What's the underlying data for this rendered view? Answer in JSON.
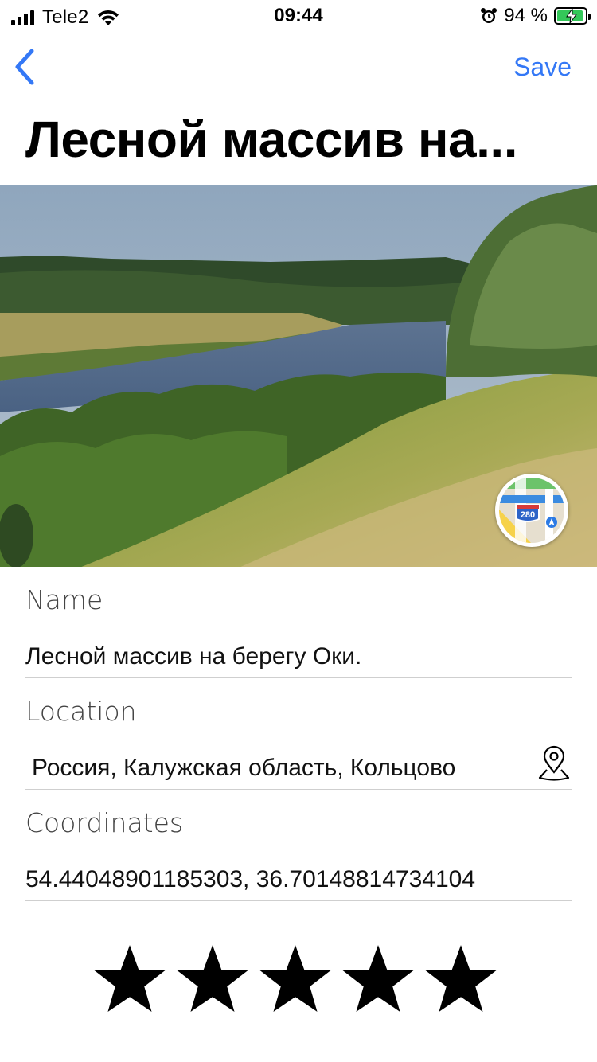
{
  "status_bar": {
    "carrier": "Tele2",
    "time": "09:44",
    "battery_percent": "94 %",
    "battery_level": 0.94,
    "icons": [
      "signal-icon",
      "wifi-icon",
      "alarm-icon",
      "battery-charging-icon"
    ]
  },
  "nav": {
    "back_icon": "chevron-left-icon",
    "save_label": "Save",
    "accent_color": "#3478f6"
  },
  "page": {
    "title": "Лесной массив на..."
  },
  "photo": {
    "maps_icon": "apple-maps-icon",
    "maps_shield_text": "280"
  },
  "form": {
    "name_label": "Name",
    "name_value": "Лесной массив на берегу Оки.",
    "location_label": "Location",
    "location_value": "Россия, Калужская область, Кольцово",
    "location_icon": "location-pin-icon",
    "coordinates_label": "Coordinates",
    "coordinates_value": "54.44048901185303, 36.70148814734104"
  },
  "rating": {
    "value": 5,
    "max": 5
  }
}
